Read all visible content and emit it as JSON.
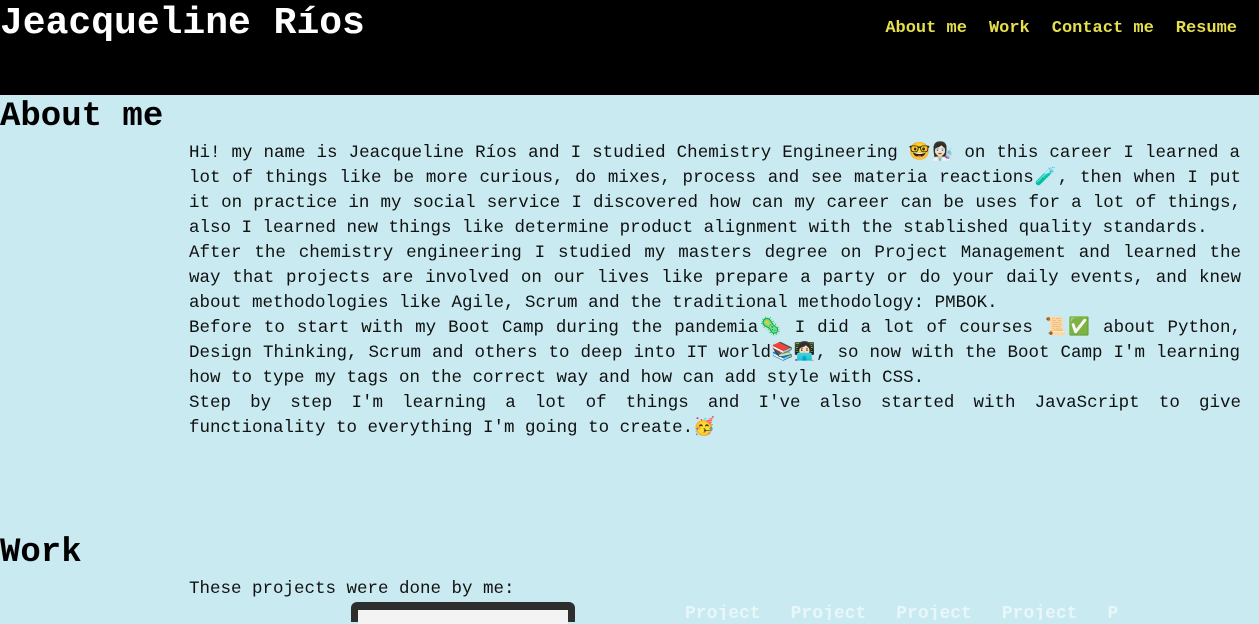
{
  "header": {
    "site_title": "Jeacqueline Ríos",
    "nav": {
      "about": "About me",
      "work": "Work",
      "contact": "Contact me",
      "resume": "Resume"
    }
  },
  "about": {
    "heading": "About me",
    "paragraphs": [
      "Hi! my name is Jeacqueline Ríos and I studied Chemistry Engineering 🤓👩🏻‍🔬 on this career I learned a lot of things like be more curious, do mixes, process and see materia reactions🧪, then when I put it on practice in my social service I discovered how can my career can be uses for a lot of things, also I learned new things like determine product alignment with the stablished quality standards.",
      "After the chemistry engineering I studied my masters degree on Project Management and learned the way that projects are involved on our lives like prepare a party or do your daily events, and knew about methodologies like Agile, Scrum and the traditional methodology: PMBOK.",
      "Before to start with my Boot Camp during the pandemia🦠 I did a lot of courses 📜✅ about Python, Design Thinking, Scrum and others to deep into IT world📚👩🏻‍💻, so now with the Boot Camp I'm learning how to type my tags on the correct way and how can add style with CSS.",
      "Step by step I'm learning a lot of things and I've also started with JavaScript to give functionality to everything I'm going to create.🥳"
    ]
  },
  "work": {
    "heading": "Work",
    "intro": "These projects were done by me:",
    "project_labels": [
      "Project",
      "Project",
      "Project",
      "Project",
      "P"
    ]
  },
  "colors": {
    "background": "#c8eaf0",
    "header_bg": "#000000",
    "nav_link": "#e5df4d",
    "title": "#ffffff"
  }
}
